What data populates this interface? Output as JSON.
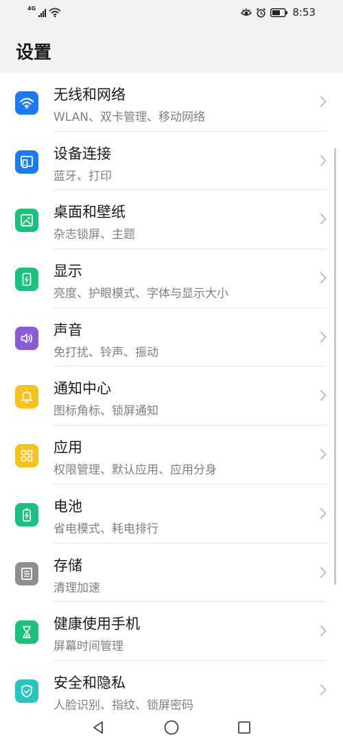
{
  "status_bar": {
    "network_type": "4G",
    "time": "8:53",
    "icons": [
      "signal-icon",
      "wifi-icon",
      "eye-comfort-icon",
      "alarm-icon",
      "battery-icon"
    ]
  },
  "header": {
    "title": "设置"
  },
  "settings": [
    {
      "title": "无线和网络",
      "subtitle": "WLAN、双卡管理、移动网络",
      "icon": "wifi-icon",
      "color": "#1a7cf5"
    },
    {
      "title": "设备连接",
      "subtitle": "蓝牙、打印",
      "icon": "device-connection-icon",
      "color": "#1a7cf5"
    },
    {
      "title": "桌面和壁纸",
      "subtitle": "杂志锁屏、主题",
      "icon": "wallpaper-icon",
      "color": "#19c27c"
    },
    {
      "title": "显示",
      "subtitle": "亮度、护眼模式、字体与显示大小",
      "icon": "display-icon",
      "color": "#19c27c"
    },
    {
      "title": "声音",
      "subtitle": "免打扰、铃声、振动",
      "icon": "sound-icon",
      "color": "#8a5bd9"
    },
    {
      "title": "通知中心",
      "subtitle": "图标角标、锁屏通知",
      "icon": "bell-icon",
      "color": "#f8c21c"
    },
    {
      "title": "应用",
      "subtitle": "权限管理、默认应用、应用分身",
      "icon": "apps-icon",
      "color": "#f8c21c"
    },
    {
      "title": "电池",
      "subtitle": "省电模式、耗电排行",
      "icon": "battery-icon",
      "color": "#19c27c"
    },
    {
      "title": "存储",
      "subtitle": "清理加速",
      "icon": "storage-icon",
      "color": "#8e8e8e"
    },
    {
      "title": "健康使用手机",
      "subtitle": "屏幕时间管理",
      "icon": "hourglass-icon",
      "color": "#19c27c"
    },
    {
      "title": "安全和隐私",
      "subtitle": "人脸识别、指纹、锁屏密码",
      "icon": "shield-icon",
      "color": "#26c6c0"
    }
  ],
  "nav_bar": {
    "buttons": [
      "back-icon",
      "home-icon",
      "recents-icon"
    ]
  }
}
